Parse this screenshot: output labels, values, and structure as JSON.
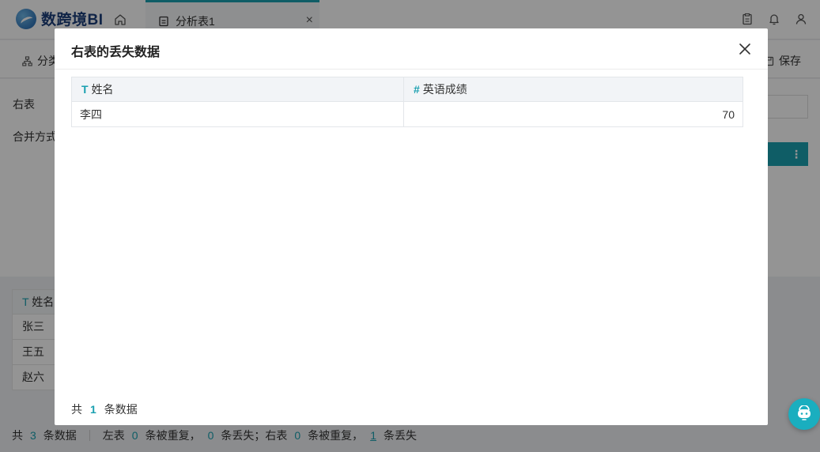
{
  "app": {
    "brand": "数跨境BI"
  },
  "tabs": [
    {
      "label": "分析表1",
      "close": "×"
    }
  ],
  "toolbar": {
    "left_label": "分类",
    "save_label": "保存"
  },
  "config": {
    "right_table_label": "右表",
    "merge_mode_label": "合并方式"
  },
  "bg_table": {
    "header": "姓名",
    "header_icon": "T",
    "rows": [
      "张三",
      "王五",
      "赵六"
    ]
  },
  "status": {
    "total_prefix": "共",
    "total": "3",
    "total_suffix": "条数据",
    "left_prefix": "左表",
    "left_dup": "0",
    "left_dup_suffix": "条被重复，",
    "left_lost": "0",
    "left_lost_suffix": "条丢失；右表",
    "right_dup": "0",
    "right_dup_suffix": "条被重复，",
    "right_lost": "1",
    "right_lost_suffix": "条丢失"
  },
  "modal": {
    "title": "右表的丢失数据",
    "columns": [
      {
        "label": "姓名",
        "type_icon": "T",
        "type": "text"
      },
      {
        "label": "英语成绩",
        "type_icon": "#",
        "type": "number"
      }
    ],
    "rows": [
      {
        "name": "李四",
        "score": "70"
      }
    ],
    "footer_prefix": "共",
    "footer_count": "1",
    "footer_suffix": "条数据"
  },
  "colors": {
    "accent": "#1aa0b0",
    "help_button": "#1aaebf"
  }
}
